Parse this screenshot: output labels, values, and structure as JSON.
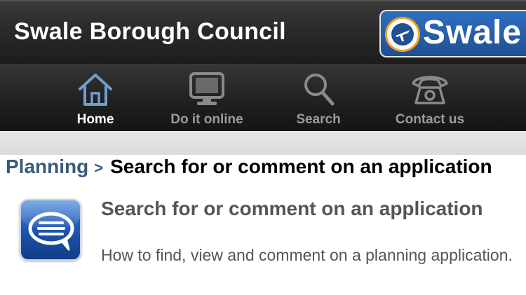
{
  "header": {
    "title": "Swale Borough Council",
    "logo_text": "Swale"
  },
  "tabs": [
    {
      "label": "Home",
      "icon": "home-icon",
      "active": true
    },
    {
      "label": "Do it online",
      "icon": "monitor-icon",
      "active": false
    },
    {
      "label": "Search",
      "icon": "search-icon",
      "active": false
    },
    {
      "label": "Contact us",
      "icon": "phone-icon",
      "active": false
    }
  ],
  "breadcrumb": {
    "parent": "Planning",
    "separator": ">",
    "current": "Search for or comment on an application"
  },
  "item": {
    "icon": "speech-bubble-icon",
    "title": "Search for or comment on an application",
    "description": "How to find, view and comment on a planning application."
  },
  "colors": {
    "header_bg": "#2a2a2a",
    "logo_blue": "#1f4f95",
    "logo_orange": "#f4a021",
    "breadcrumb_link": "#3a5a7a",
    "active_icon": "#6f9fd0",
    "inactive_icon": "#8a8a8a"
  }
}
